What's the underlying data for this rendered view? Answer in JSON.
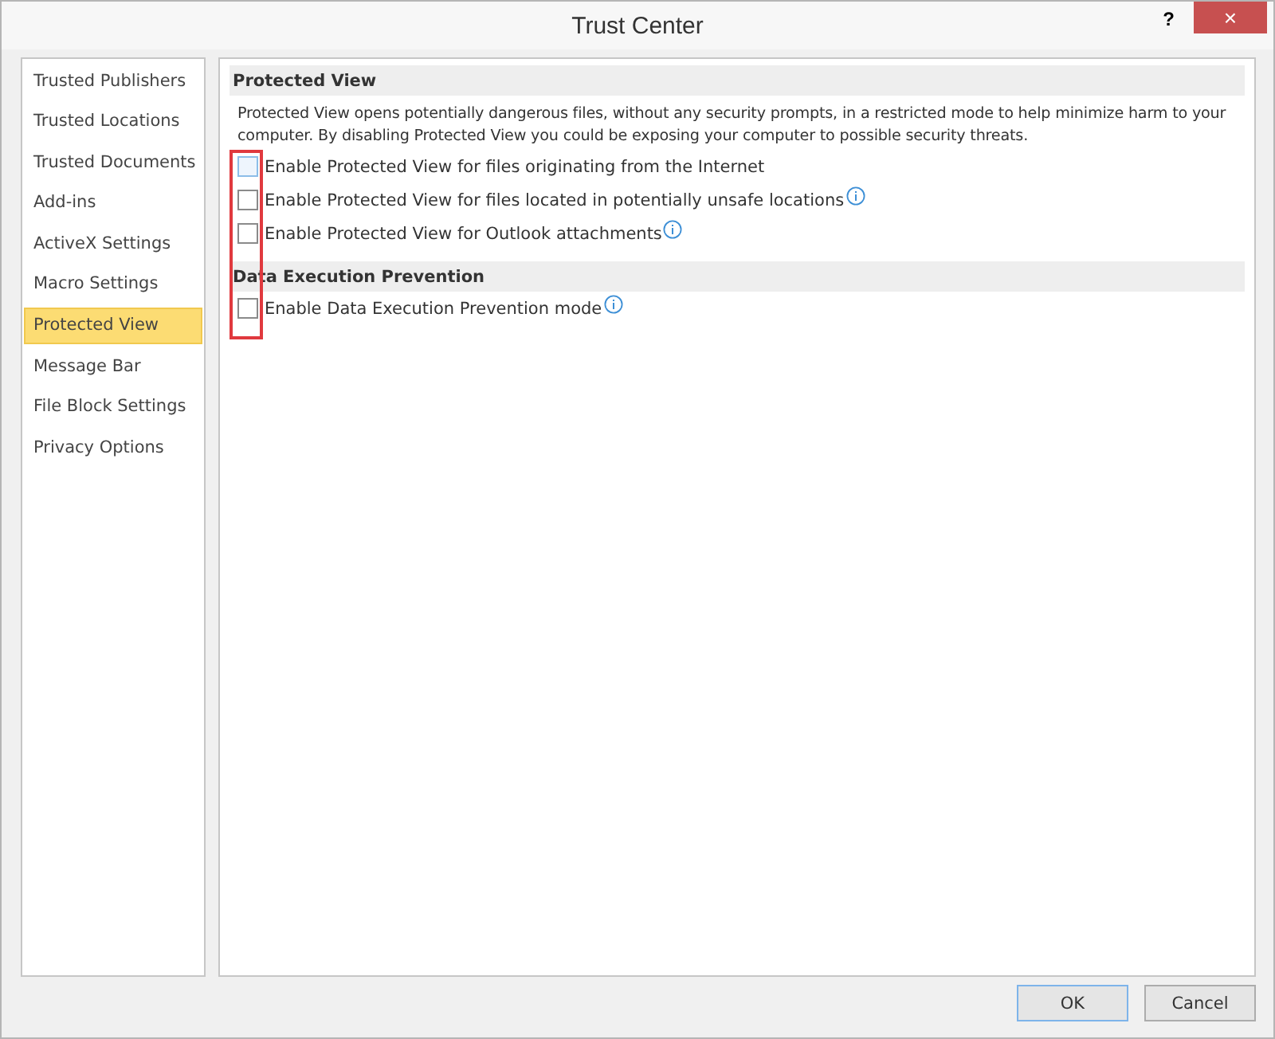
{
  "window": {
    "title": "Trust Center",
    "help": "?",
    "close": "×"
  },
  "sidebar": {
    "items": [
      {
        "label": "Trusted Publishers",
        "selected": false
      },
      {
        "label": "Trusted Locations",
        "selected": false
      },
      {
        "label": "Trusted Documents",
        "selected": false
      },
      {
        "label": "Add-ins",
        "selected": false
      },
      {
        "label": "ActiveX Settings",
        "selected": false
      },
      {
        "label": "Macro Settings",
        "selected": false
      },
      {
        "label": "Protected View",
        "selected": true
      },
      {
        "label": "Message Bar",
        "selected": false
      },
      {
        "label": "File Block Settings",
        "selected": false
      },
      {
        "label": "Privacy Options",
        "selected": false
      }
    ]
  },
  "sections": [
    {
      "title": "Protected View",
      "description": "Protected View opens potentially dangerous files, without any security prompts, in a restricted mode to help minimize harm to your computer. By disabling Protected View you could be exposing your computer to possible security threats.",
      "options": [
        {
          "label": "Enable Protected View for files originating from the Internet",
          "checked": false,
          "focused": true,
          "info": false
        },
        {
          "label": "Enable Protected View for files located in potentially unsafe locations",
          "checked": false,
          "focused": false,
          "info": true
        },
        {
          "label": "Enable Protected View for Outlook attachments",
          "checked": false,
          "focused": false,
          "info": true
        }
      ]
    },
    {
      "title": "Data Execution Prevention",
      "options": [
        {
          "label": "Enable Data Execution Prevention mode",
          "checked": false,
          "focused": false,
          "info": true
        }
      ]
    }
  ],
  "buttons": [
    {
      "label": "OK",
      "default": true
    },
    {
      "label": "Cancel",
      "default": false
    }
  ]
}
